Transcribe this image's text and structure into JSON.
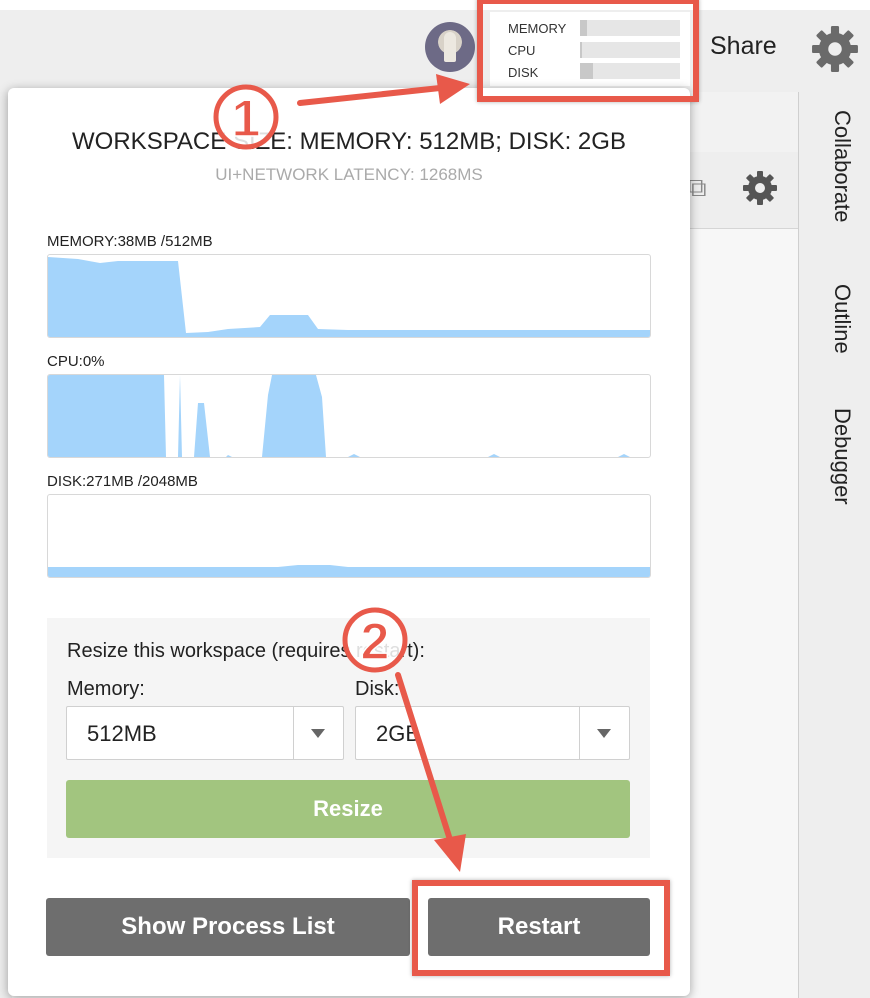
{
  "app": {
    "usage_widget": {
      "rows": [
        {
          "label": "MEMORY",
          "fill": 0.07
        },
        {
          "label": "CPU",
          "fill": 0.02
        },
        {
          "label": "DISK",
          "fill": 0.13
        }
      ]
    },
    "share_label": "Share",
    "sidebar_tabs": [
      "Collaborate",
      "Outline",
      "Debugger"
    ]
  },
  "popover": {
    "title": "WORKSPACE SIZE: MEMORY: 512MB; DISK: 2GB",
    "subtitle": "UI+NETWORK LATENCY: 1268MS",
    "graphs": {
      "memory": {
        "label": "MEMORY:38MB /512MB"
      },
      "cpu": {
        "label": "CPU:0%"
      },
      "disk": {
        "label": "DISK:271MB /2048MB"
      }
    },
    "resize": {
      "title": "Resize this workspace (requires restart):",
      "memory_label": "Memory:",
      "memory_value": "512MB",
      "disk_label": "Disk:",
      "disk_value": "2GB",
      "button_label": "Resize"
    },
    "process_list_label": "Show Process List",
    "restart_label": "Restart"
  },
  "annotations": {
    "step1": "1",
    "step2": "2"
  },
  "colors": {
    "graph_fill": "#a4d4fb",
    "highlight": "#e8594a",
    "resize_button": "#a2c57f",
    "dark_button": "#6e6e6e"
  }
}
